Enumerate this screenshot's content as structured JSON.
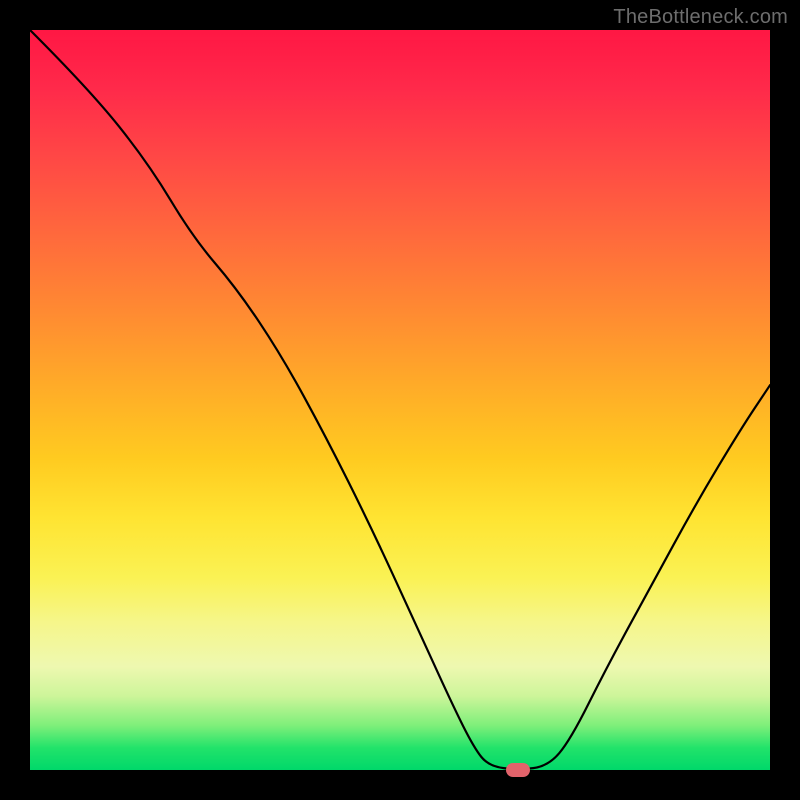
{
  "watermark": "TheBottleneck.com",
  "colors": {
    "marker": "#e2636b",
    "curve_stroke": "#000000",
    "frame_bg": "#000000"
  },
  "chart_data": {
    "type": "line",
    "title": "",
    "xlabel": "",
    "ylabel": "",
    "xlim": [
      0,
      100
    ],
    "ylim": [
      0,
      100
    ],
    "grid": false,
    "legend": false,
    "curve_points": [
      {
        "x": 0,
        "y": 100
      },
      {
        "x": 8,
        "y": 92
      },
      {
        "x": 16,
        "y": 82
      },
      {
        "x": 22,
        "y": 72
      },
      {
        "x": 28,
        "y": 65
      },
      {
        "x": 34,
        "y": 56
      },
      {
        "x": 40,
        "y": 45
      },
      {
        "x": 46,
        "y": 33
      },
      {
        "x": 52,
        "y": 20
      },
      {
        "x": 57,
        "y": 9
      },
      {
        "x": 60,
        "y": 3
      },
      {
        "x": 62,
        "y": 0.5
      },
      {
        "x": 66,
        "y": 0
      },
      {
        "x": 70,
        "y": 0.5
      },
      {
        "x": 73,
        "y": 4
      },
      {
        "x": 78,
        "y": 14
      },
      {
        "x": 84,
        "y": 25
      },
      {
        "x": 90,
        "y": 36
      },
      {
        "x": 96,
        "y": 46
      },
      {
        "x": 100,
        "y": 52
      }
    ],
    "marker": {
      "x": 66,
      "y": 0
    }
  }
}
